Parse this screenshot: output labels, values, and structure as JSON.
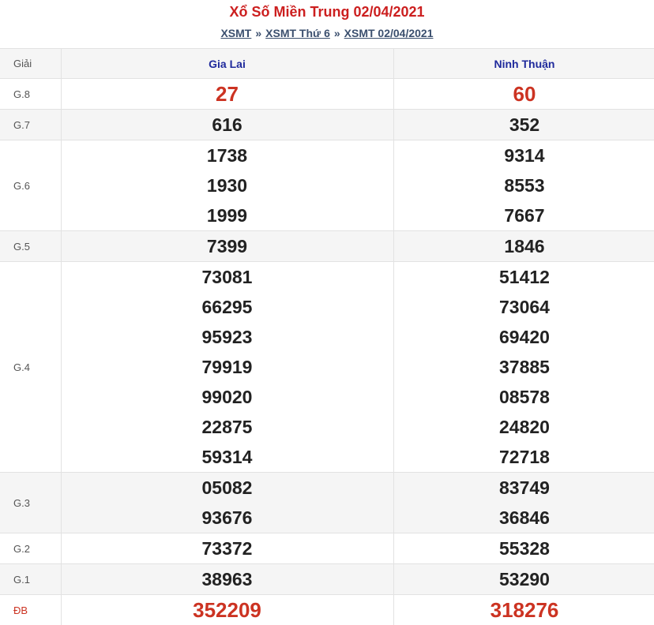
{
  "title": "Xổ Số Miền Trung 02/04/2021",
  "breadcrumb": [
    "XSMT",
    "XSMT Thứ 6",
    "XSMT 02/04/2021"
  ],
  "breadcrumb_separator": "»",
  "table": {
    "header": {
      "prize": "Giải",
      "province_a": "Gia Lai",
      "province_b": "Ninh Thuận"
    },
    "rows": [
      {
        "prize": "G.8",
        "a": [
          "27"
        ],
        "b": [
          "60"
        ],
        "highlight": true
      },
      {
        "prize": "G.7",
        "a": [
          "616"
        ],
        "b": [
          "352"
        ]
      },
      {
        "prize": "G.6",
        "a": [
          "1738",
          "1930",
          "1999"
        ],
        "b": [
          "9314",
          "8553",
          "7667"
        ]
      },
      {
        "prize": "G.5",
        "a": [
          "7399"
        ],
        "b": [
          "1846"
        ]
      },
      {
        "prize": "G.4",
        "a": [
          "73081",
          "66295",
          "95923",
          "79919",
          "99020",
          "22875",
          "59314"
        ],
        "b": [
          "51412",
          "73064",
          "69420",
          "37885",
          "08578",
          "24820",
          "72718"
        ]
      },
      {
        "prize": "G.3",
        "a": [
          "05082",
          "93676"
        ],
        "b": [
          "83749",
          "36846"
        ]
      },
      {
        "prize": "G.2",
        "a": [
          "73372"
        ],
        "b": [
          "55328"
        ]
      },
      {
        "prize": "G.1",
        "a": [
          "38963"
        ],
        "b": [
          "53290"
        ]
      },
      {
        "prize": "ĐB",
        "a": [
          "352209"
        ],
        "b": [
          "318276"
        ],
        "highlight": true
      }
    ]
  },
  "colors": {
    "title": "#cc1f1f",
    "header_text": "#1f2a9c",
    "highlight_number": "#cc3322",
    "row_shade": "#f5f5f5",
    "border": "#e2e2e2"
  }
}
